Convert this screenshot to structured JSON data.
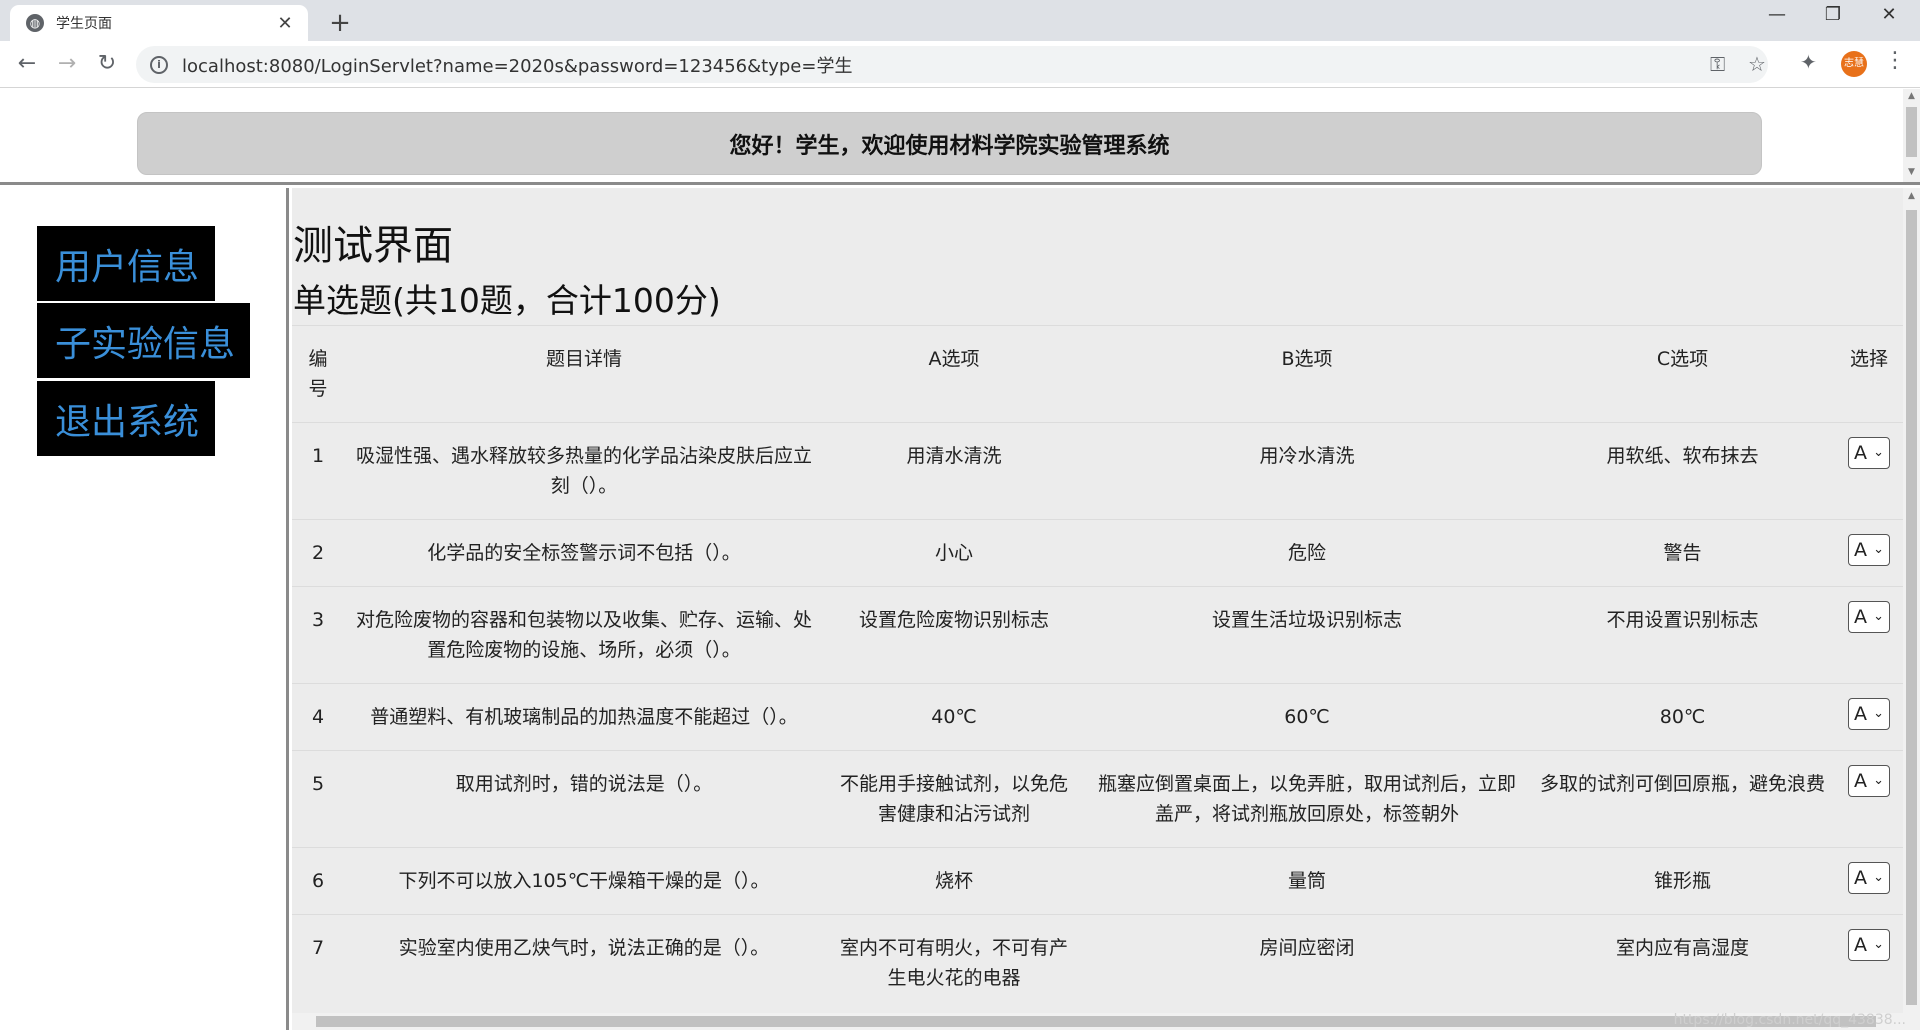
{
  "browser": {
    "tab_title": "学生页面",
    "tab_close": "✕",
    "new_tab": "+",
    "url": "localhost:8080/LoginServlet?name=2020s&password=123456&type=学生",
    "profile_label": "志慧",
    "window_controls": {
      "minimize": "—",
      "maximize": "❐",
      "close": "✕"
    },
    "icons": [
      "globe-icon",
      "back-icon",
      "forward-icon",
      "reload-icon",
      "info-icon",
      "key-icon",
      "star-icon",
      "extensions-icon",
      "menu-icon"
    ]
  },
  "header": {
    "banner_text": "您好！学生，欢迎使用材料学院实验管理系统"
  },
  "sidebar": {
    "items": [
      {
        "label": "用户信息"
      },
      {
        "label": "子实验信息"
      },
      {
        "label": "退出系统"
      }
    ],
    "colors": {
      "background": "#000000",
      "text": "#3a8fd9"
    }
  },
  "main": {
    "title": "测试界面",
    "subtitle": "单选题(共10题，合计100分)",
    "columns": {
      "no": "编号",
      "question": "题目详情",
      "a": "A选项",
      "b": "B选项",
      "c": "C选项",
      "select": "选择"
    },
    "rows": [
      {
        "no": "1",
        "question": "吸湿性强、遇水释放较多热量的化学品沾染皮肤后应立刻（）。",
        "a": "用清水清洗",
        "b": "用冷水清洗",
        "c": "用软纸、软布抹去",
        "selected": "A"
      },
      {
        "no": "2",
        "question": "化学品的安全标签警示词不包括（）。",
        "a": "小心",
        "b": "危险",
        "c": "警告",
        "selected": "A"
      },
      {
        "no": "3",
        "question": "对危险废物的容器和包装物以及收集、贮存、运输、处置危险废物的设施、场所，必须（）。",
        "a": "设置危险废物识别标志",
        "b": "设置生活垃圾识别标志",
        "c": "不用设置识别标志",
        "selected": "A"
      },
      {
        "no": "4",
        "question": "普通塑料、有机玻璃制品的加热温度不能超过（）。",
        "a": "40℃",
        "b": "60℃",
        "c": "80℃",
        "selected": "A"
      },
      {
        "no": "5",
        "question": "取用试剂时，错的说法是（）。",
        "a": "不能用手接触试剂，以免危害健康和沾污试剂",
        "b": "瓶塞应倒置桌面上，以免弄脏，取用试剂后，立即盖严，将试剂瓶放回原处，标签朝外",
        "c": "多取的试剂可倒回原瓶，避免浪费",
        "selected": "A"
      },
      {
        "no": "6",
        "question": "下列不可以放入105℃干燥箱干燥的是（）。",
        "a": "烧杯",
        "b": "量筒",
        "c": "锥形瓶",
        "selected": "A"
      },
      {
        "no": "7",
        "question": "实验室内使用乙炔气时，说法正确的是（）。",
        "a": "室内不可有明火，不可有产生电火花的电器",
        "b": "房间应密闭",
        "c": "室内应有高湿度",
        "selected": "A"
      }
    ]
  },
  "watermark": "https://blog.csdn.net/qq_43838..."
}
